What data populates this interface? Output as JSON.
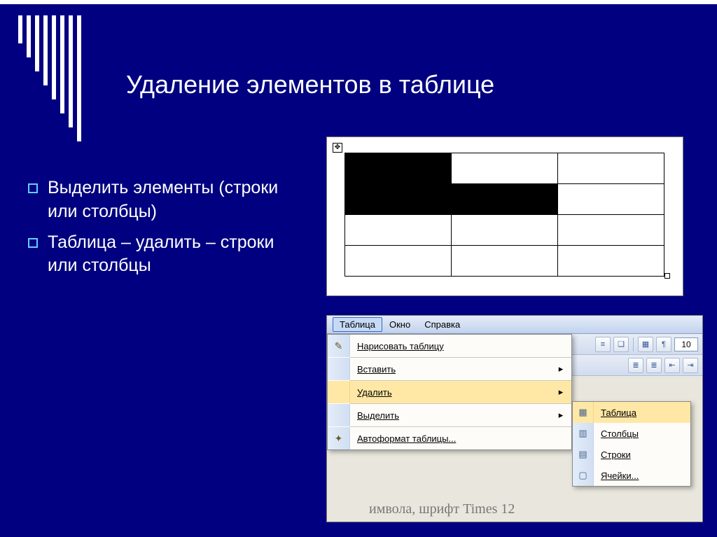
{
  "slide": {
    "title": "Удаление элементов в таблице",
    "bullets": [
      "Выделить элементы (строки или столбцы)",
      "Таблица – удалить – строки или столбцы"
    ],
    "stripe_heights": [
      40,
      60,
      80,
      100,
      120,
      140,
      160,
      180
    ]
  },
  "word_ui": {
    "menubar": [
      "Таблица",
      "Окно",
      "Справка"
    ],
    "active_menu_index": 0,
    "dropdown": [
      {
        "label": "Нарисовать таблицу",
        "icon": "✎",
        "submenu": false
      },
      {
        "label": "Вставить",
        "icon": "",
        "submenu": true
      },
      {
        "label": "Удалить",
        "icon": "",
        "submenu": true,
        "hover": true
      },
      {
        "label": "Выделить",
        "icon": "",
        "submenu": true
      },
      {
        "label": "Автоформат таблицы...",
        "icon": "✦",
        "submenu": false
      }
    ],
    "submenu_items": [
      {
        "label": "Таблица",
        "icon": "▦",
        "hover": true
      },
      {
        "label": "Столбцы",
        "icon": "▥"
      },
      {
        "label": "Строки",
        "icon": "▤"
      },
      {
        "label": "Ячейки...",
        "icon": "▢"
      }
    ],
    "bg_text": "имвола, шрифт Times 12",
    "zoom": "10"
  }
}
